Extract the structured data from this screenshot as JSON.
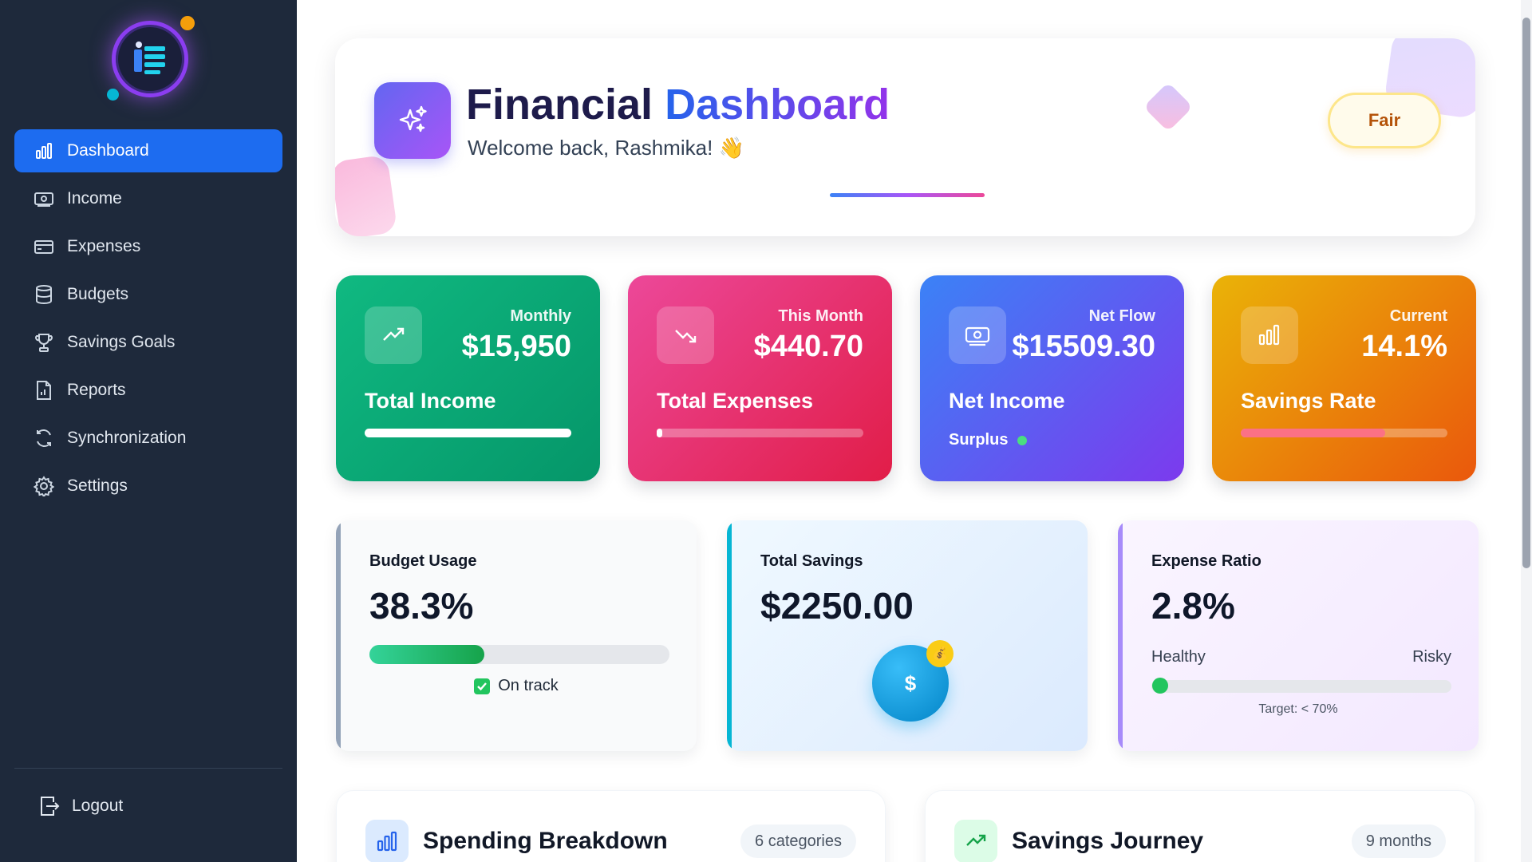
{
  "sidebar": {
    "items": [
      {
        "label": "Dashboard",
        "icon": "bar-chart-icon",
        "active": true
      },
      {
        "label": "Income",
        "icon": "banknote-icon"
      },
      {
        "label": "Expenses",
        "icon": "credit-card-icon"
      },
      {
        "label": "Budgets",
        "icon": "database-icon"
      },
      {
        "label": "Savings Goals",
        "icon": "trophy-icon"
      },
      {
        "label": "Reports",
        "icon": "report-file-icon"
      },
      {
        "label": "Synchronization",
        "icon": "sync-icon"
      },
      {
        "label": "Settings",
        "icon": "gear-icon"
      }
    ],
    "logout_label": "Logout"
  },
  "header": {
    "title_part1": "Financial",
    "title_part2": "Dashboard",
    "subtitle": "Welcome back, Rashmika! 👋",
    "health_badge": "Fair"
  },
  "stats": {
    "income": {
      "label": "Monthly",
      "value": "$15,950",
      "title": "Total Income",
      "progress": 1.0
    },
    "expenses": {
      "label": "This Month",
      "value": "$440.70",
      "title": "Total Expenses",
      "progress": 0.028
    },
    "net": {
      "label": "Net Flow",
      "value": "$15509.30",
      "title": "Net Income",
      "status": "Surplus"
    },
    "savings_rate": {
      "label": "Current",
      "value": "14.1%",
      "title": "Savings Rate",
      "progress": 0.7
    }
  },
  "budget_usage": {
    "title": "Budget Usage",
    "value": "38.3%",
    "progress": 0.383,
    "status": "On track"
  },
  "total_savings": {
    "title": "Total Savings",
    "value": "$2250.00",
    "coin_symbol": "$",
    "badge_emoji": "💰"
  },
  "expense_ratio": {
    "title": "Expense Ratio",
    "value": "2.8%",
    "left_label": "Healthy",
    "right_label": "Risky",
    "level": 0.028,
    "target": "Target: < 70%"
  },
  "spending": {
    "title": "Spending Breakdown",
    "pill": "6 categories"
  },
  "journey": {
    "title": "Savings Journey",
    "pill": "9 months"
  },
  "colors": {
    "sidebar_bg": "#1e293b",
    "active_nav": "#1d6cf0",
    "income_card": "#10b981",
    "expenses_card": "#e11d48",
    "net_card": "#7c3aed",
    "savings_card": "#f59e0b"
  }
}
